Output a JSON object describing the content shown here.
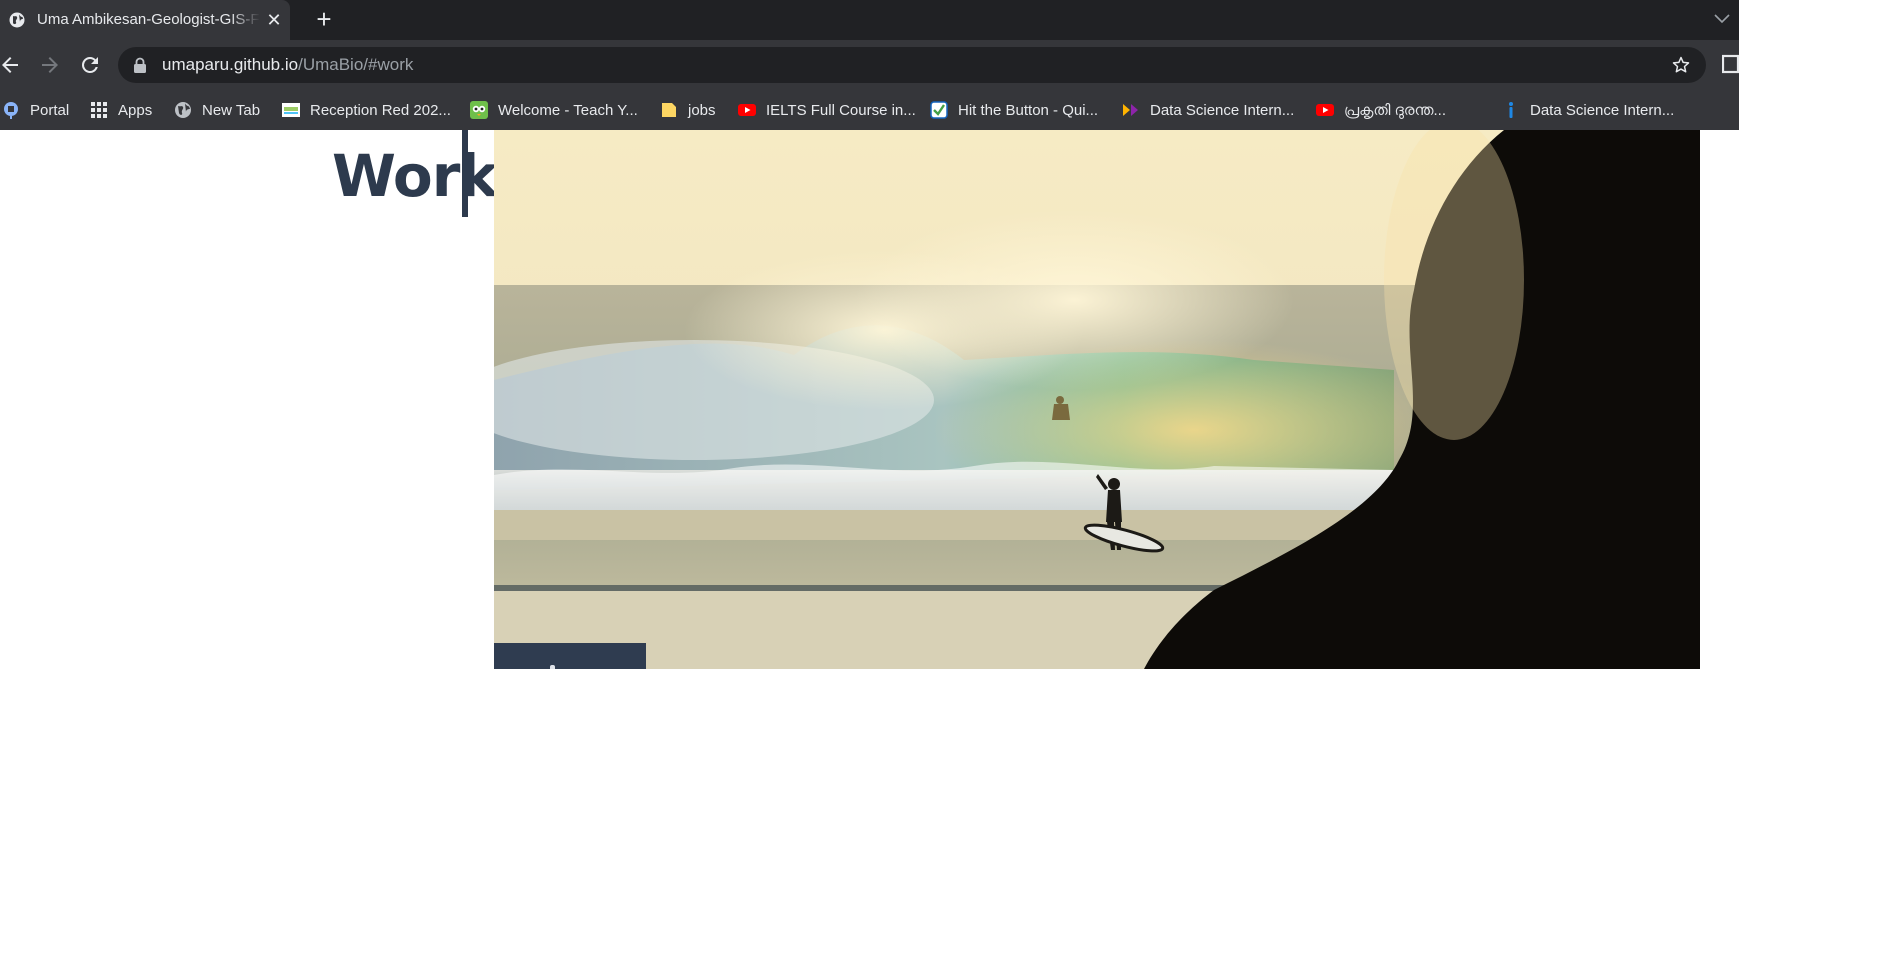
{
  "browser": {
    "tab": {
      "title": "Uma Ambikesan-Geologist-GIS-F",
      "close_glyph": "✕",
      "favicon": "globe-icon"
    },
    "new_tab_glyph": "+",
    "address": {
      "host": "umaparu.github.io",
      "path": "/UmaBio/#work"
    },
    "bookmarks": [
      {
        "label": "Portal",
        "icon": "portal-icon"
      },
      {
        "label": "Apps",
        "icon": "apps-grid-icon"
      },
      {
        "label": "New Tab",
        "icon": "globe-icon"
      },
      {
        "label": "Reception Red 202...",
        "icon": "reception-icon"
      },
      {
        "label": "Welcome - Teach Y...",
        "icon": "owl-icon"
      },
      {
        "label": "jobs",
        "icon": "folder-icon"
      },
      {
        "label": "IELTS Full Course in...",
        "icon": "youtube-icon"
      },
      {
        "label": "Hit the Button - Qui...",
        "icon": "checkmark-icon"
      },
      {
        "label": "Data Science Intern...",
        "icon": "internshala-icon"
      },
      {
        "label": "പ്രകൃതി ദുരന്ത...",
        "icon": "youtube-icon"
      },
      {
        "label": "Data Science Intern...",
        "icon": "info-icon"
      }
    ],
    "colors": {
      "frame": "#202124",
      "toolbar": "#35363a",
      "text": "#e8eaed",
      "youtube": "#ff0000"
    }
  },
  "page": {
    "heading": "Work",
    "heading_color": "#2d3a4d",
    "hero_image": "surfer-at-sunset-photo",
    "caption_tab_color": "#2f3c50"
  }
}
